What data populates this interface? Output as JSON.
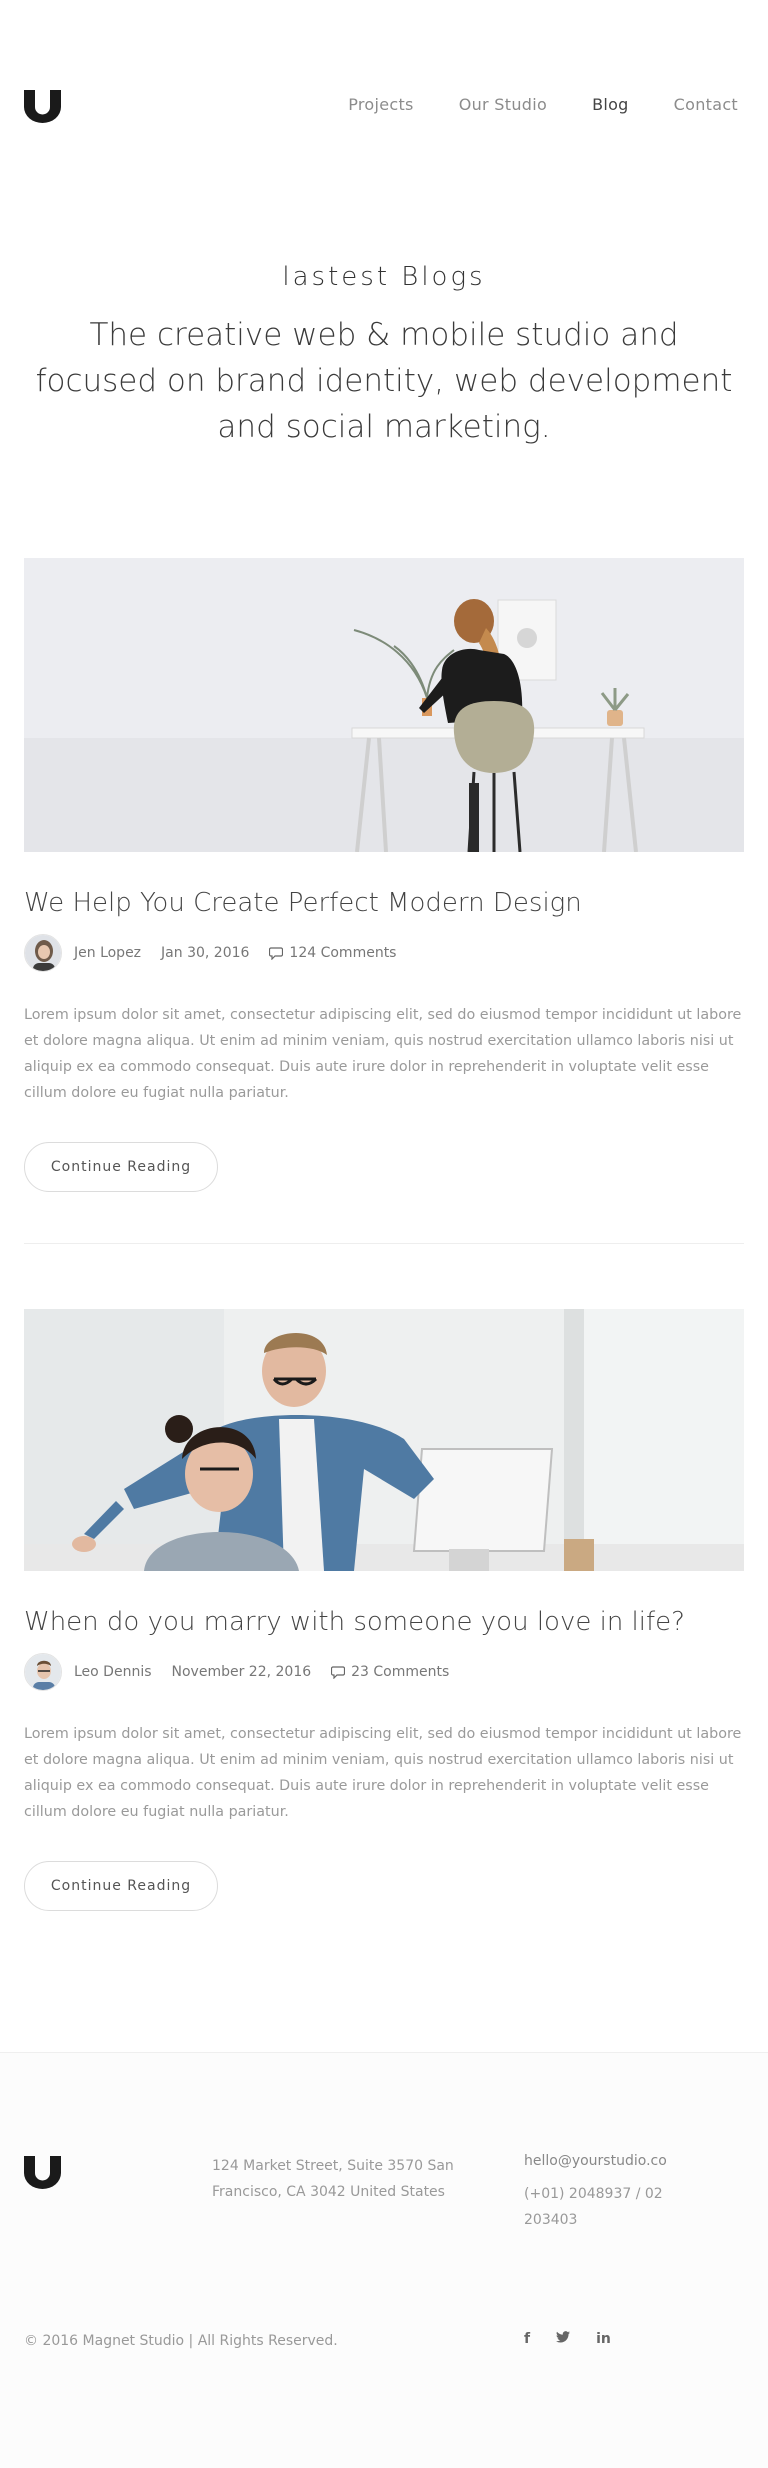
{
  "nav": {
    "items": [
      {
        "label": "Projects"
      },
      {
        "label": "Our Studio"
      },
      {
        "label": "Blog"
      },
      {
        "label": "Contact"
      }
    ]
  },
  "hero": {
    "kicker": "lastest Blogs",
    "headline": "The creative web & mobile studio and focused on brand identity, web development and social marketing."
  },
  "posts": [
    {
      "title": "We Help You Create Perfect Modern Design",
      "author": "Jen Lopez",
      "date": "Jan 30, 2016",
      "comments": "124 Comments",
      "excerpt": "Lorem ipsum dolor sit amet, consectetur adipiscing elit, sed do eiusmod tempor incididunt ut labore et dolore magna aliqua. Ut enim ad minim veniam, quis nostrud exercitation ullamco laboris nisi ut aliquip ex ea commodo consequat. Duis aute irure dolor in reprehenderit in voluptate velit esse cillum dolore eu fugiat nulla pariatur.",
      "button": "Continue Reading"
    },
    {
      "title": "When do you marry with someone you love in life?",
      "author": "Leo Dennis",
      "date": "November 22, 2016",
      "comments": "23 Comments",
      "excerpt": "Lorem ipsum dolor sit amet, consectetur adipiscing elit, sed do eiusmod tempor incididunt ut labore et dolore magna aliqua. Ut enim ad minim veniam, quis nostrud exercitation ullamco laboris nisi ut aliquip ex ea commodo consequat. Duis aute irure dolor in reprehenderit in voluptate velit esse cillum dolore eu fugiat nulla pariatur.",
      "button": "Continue Reading"
    }
  ],
  "footer": {
    "address": "124 Market Street, Suite 3570 San Francisco, CA 3042 United States",
    "email": "hello@yourstudio.co",
    "phone": "(+01) 2048937 / 02 203403",
    "copyright": "© 2016 Magnet Studio | All Rights Reserved.",
    "social": [
      {
        "icon": "facebook-icon",
        "glyph": "f"
      },
      {
        "icon": "twitter-icon",
        "glyph": "🐦"
      },
      {
        "icon": "linkedin-icon",
        "glyph": "in"
      }
    ]
  },
  "colors": {
    "text": "#555555",
    "muted": "#9a9a9a",
    "logo": "#1a1a1a"
  }
}
